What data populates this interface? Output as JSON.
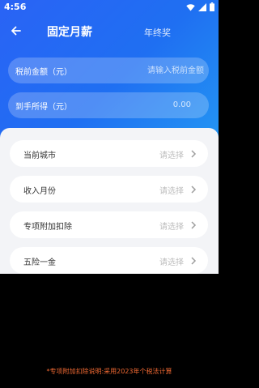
{
  "status_bar": {
    "time": "4:56",
    "icons": [
      "wifi-icon",
      "signal-icon",
      "battery-icon"
    ]
  },
  "app_bar": {
    "back_icon": "arrow-left-icon",
    "tabs": [
      {
        "label": "固定月薪",
        "active": true
      },
      {
        "label": "年终奖",
        "active": false
      }
    ]
  },
  "inputs": {
    "pretax_salary": {
      "label": "税前金额（元）",
      "placeholder": "请输入税前金额"
    },
    "take_home": {
      "label": "到手所得（元）",
      "value": "0.00"
    }
  },
  "options": [
    {
      "label": "当前城市",
      "value": "请选择"
    },
    {
      "label": "收入月份",
      "value": "请选择"
    },
    {
      "label": "专项附加扣除",
      "value": "请选择"
    },
    {
      "label": "五险一金",
      "value": "请选择"
    }
  ],
  "footnote": "*专项附加扣除说明:采用2023年个税法计算",
  "colors": {
    "header_gradient_start": "#2a63f5",
    "header_gradient_end": "#2395f3",
    "panel_background": "#f3f4f7",
    "placeholder": "#bdbdbd",
    "footnote": "#f26a33"
  }
}
